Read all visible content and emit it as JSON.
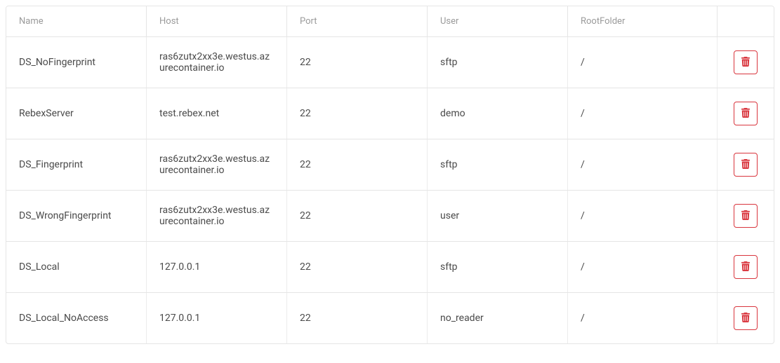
{
  "table": {
    "columns": {
      "name": "Name",
      "host": "Host",
      "port": "Port",
      "user": "User",
      "rootfolder": "RootFolder"
    },
    "rows": [
      {
        "name": "DS_NoFingerprint",
        "host": "ras6zutx2xx3e.westus.azurecontainer.io",
        "port": "22",
        "user": "sftp",
        "rootfolder": "/"
      },
      {
        "name": "RebexServer",
        "host": "test.rebex.net",
        "port": "22",
        "user": "demo",
        "rootfolder": "/"
      },
      {
        "name": "DS_Fingerprint",
        "host": "ras6zutx2xx3e.westus.azurecontainer.io",
        "port": "22",
        "user": "sftp",
        "rootfolder": "/"
      },
      {
        "name": "DS_WrongFingerprint",
        "host": "ras6zutx2xx3e.westus.azurecontainer.io",
        "port": "22",
        "user": "user",
        "rootfolder": "/"
      },
      {
        "name": "DS_Local",
        "host": "127.0.0.1",
        "port": "22",
        "user": "sftp",
        "rootfolder": "/"
      },
      {
        "name": "DS_Local_NoAccess",
        "host": "127.0.0.1",
        "port": "22",
        "user": "no_reader",
        "rootfolder": "/"
      }
    ]
  }
}
